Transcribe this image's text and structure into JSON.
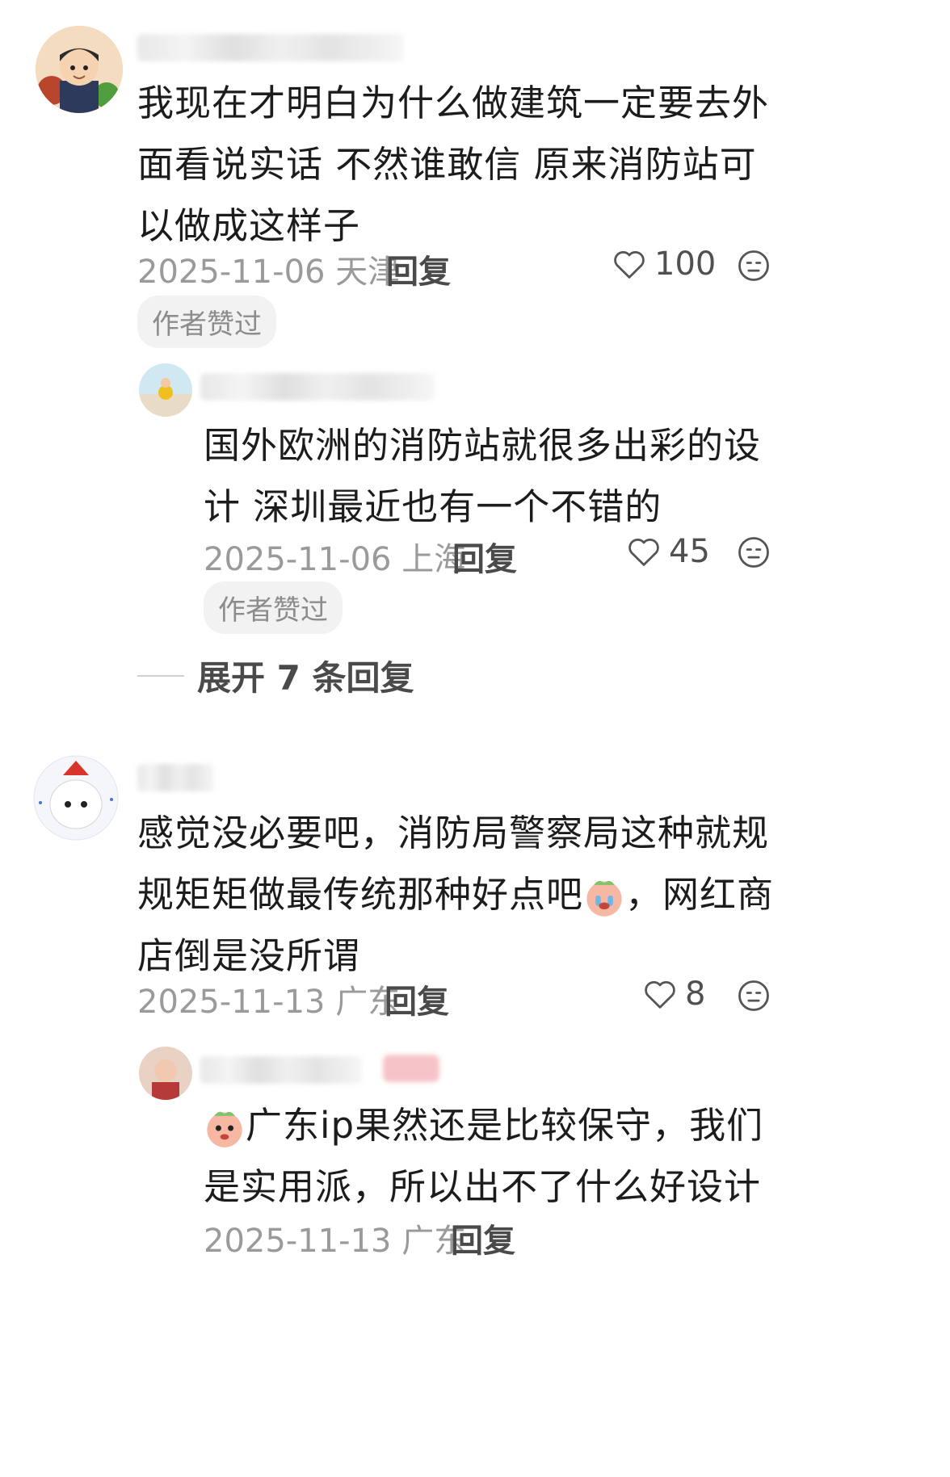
{
  "comments": [
    {
      "text": "我现在才明白为什么做建筑一定要去外面看说实话 不然谁敢信 原来消防站可以做成这样子",
      "date": "2025-11-06",
      "location": "天津",
      "reply_label": "回复",
      "likes": "100",
      "badge": "作者赞过",
      "reply": {
        "text": "国外欧洲的消防站就很多出彩的设计 深圳最近也有一个不错的",
        "date": "2025-11-06",
        "location": "上海",
        "reply_label": "回复",
        "likes": "45",
        "badge": "作者赞过"
      },
      "expand_label": "展开 7 条回复"
    },
    {
      "text_part1": "感觉没必要吧，消防局警察局这种就规规矩矩做最传统那种好点吧",
      "text_part2": "，网红商店倒是没所谓",
      "date": "2025-11-13",
      "location": "广东",
      "reply_label": "回复",
      "likes": "8",
      "reply": {
        "text": "广东ip果然还是比较保守，我们是实用派，所以出不了什么好设计",
        "date": "2025-11-13",
        "location": "广东",
        "reply_label": "回复"
      }
    }
  ],
  "icons": {
    "like": "heart-outline-icon",
    "emoji": "neutral-face-icon"
  }
}
